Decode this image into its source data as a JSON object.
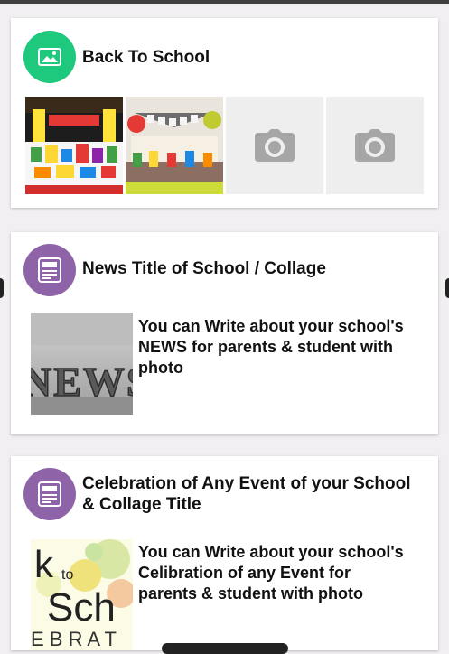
{
  "cards": [
    {
      "title": "Back To School",
      "icon": "image-icon",
      "icon_bg": "#1ec97d",
      "photos": [
        {
          "type": "photo",
          "subject": "back-to-school-party-table"
        },
        {
          "type": "photo",
          "subject": "classroom-party-banner"
        },
        {
          "type": "placeholder",
          "icon": "camera-icon"
        },
        {
          "type": "placeholder",
          "icon": "camera-icon"
        }
      ]
    },
    {
      "title": "News Title of School / Collage",
      "icon": "newspaper-icon",
      "icon_bg": "#8e63a8",
      "image_text": "NEWS",
      "body": "You  can Write about your school's\nNEWS for parents & student with\nphoto"
    },
    {
      "title": "Celebration of Any Event of your School & Collage Title",
      "icon": "newspaper-icon",
      "icon_bg": "#8e63a8",
      "image_text": {
        "line1": "k",
        "line1_small": "to",
        "line2": "Sch",
        "line3": "E B R A T"
      },
      "body": "You  can Write about your school's\nCelibration of any Event for\nparents & student with photo"
    }
  ]
}
